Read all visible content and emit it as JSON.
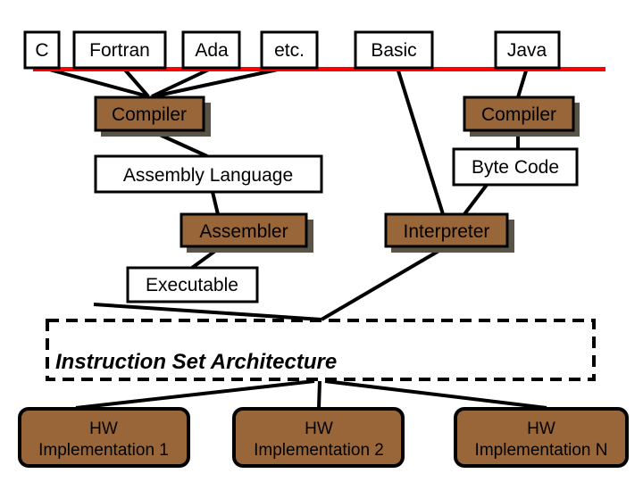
{
  "colors": {
    "brown": "#99663a",
    "red": "#ff0000",
    "shadow": "#5a5448"
  },
  "languages": [
    "C",
    "Fortran",
    "Ada",
    "etc.",
    "Basic",
    "Java"
  ],
  "compiler_left": "Compiler",
  "compiler_right": "Compiler",
  "assembly_language": "Assembly Language",
  "byte_code": "Byte Code",
  "assembler": "Assembler",
  "interpreter": "Interpreter",
  "executable": "Executable",
  "isa": "Instruction Set Architecture",
  "hw": [
    {
      "line1": "HW",
      "line2": "Implementation 1"
    },
    {
      "line1": "HW",
      "line2": "Implementation 2"
    },
    {
      "line1": "HW",
      "line2": "Implementation N"
    }
  ]
}
